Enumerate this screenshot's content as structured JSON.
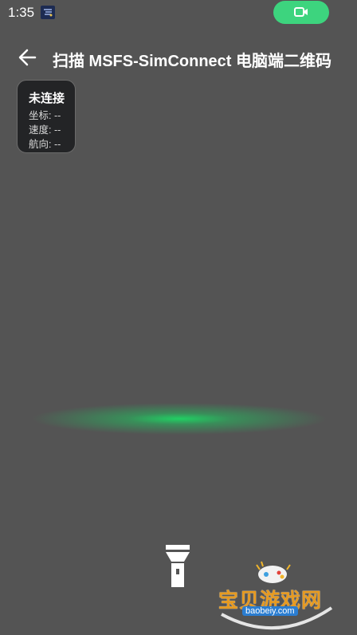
{
  "status_bar": {
    "time": "1:35",
    "app_icon": "app-notification-icon",
    "record_icon": "video-camera-icon",
    "record_color": "#3dd47e"
  },
  "header": {
    "back_icon": "back-arrow-icon",
    "title": "扫描 MSFS-SimConnect 电脑端二维码"
  },
  "status_card": {
    "title": "未连接",
    "coord": "坐标: --",
    "speed": "速度: --",
    "heading": "航向: --"
  },
  "scanner": {
    "scan_line_color": "#1ed764"
  },
  "flashlight": {
    "icon": "flashlight-icon"
  },
  "watermark": {
    "text": "宝贝游戏网",
    "url": "baobeiy.com",
    "icon": "gamepad-icon"
  }
}
